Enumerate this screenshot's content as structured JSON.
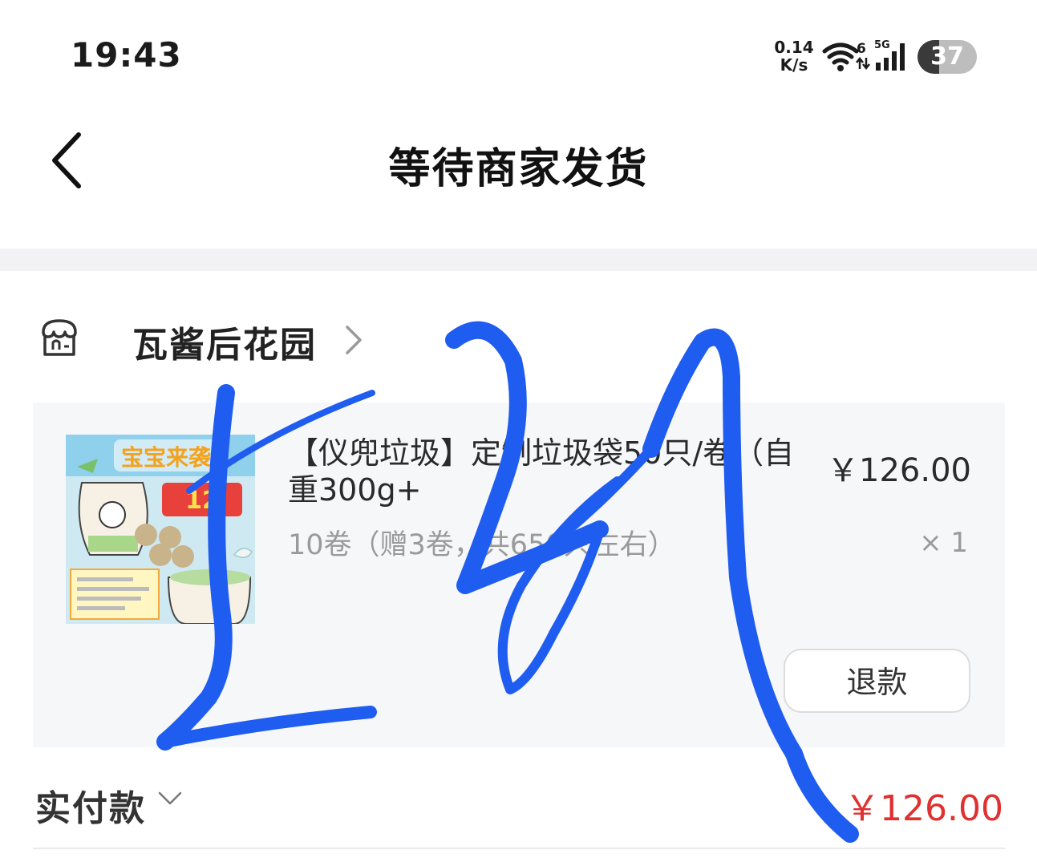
{
  "status_bar": {
    "time": "19:43",
    "net_speed_value": "0.14",
    "net_speed_unit": "K/s",
    "wifi_badge": "6",
    "cell_label": "5G",
    "battery_level": "37"
  },
  "nav": {
    "title": "等待商家发货",
    "back_icon": "chevron-left-icon"
  },
  "shop": {
    "icon": "store-icon",
    "name": "瓦酱后花园",
    "chevron_icon": "chevron-right-icon"
  },
  "product": {
    "title": "【仪兜垃圾】定制垃圾袋50只/卷（自重300g+",
    "spec": "10卷（赠3卷，共650只左右）",
    "price": "￥126.00",
    "quantity": "× 1",
    "refund_label": "退款",
    "thumb_title": "宝宝来袭",
    "thumb_badge": "12"
  },
  "total": {
    "label": "实付款",
    "amount": "￥126.00",
    "amount_color": "#e0302f"
  },
  "colors": {
    "accent_red": "#e0302f",
    "scribble_blue": "#1f5cf0",
    "card_bg": "#f6f7f9"
  }
}
